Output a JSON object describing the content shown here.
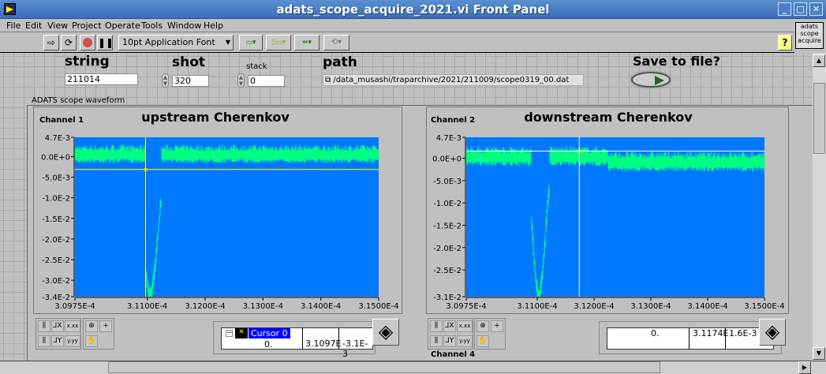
{
  "window": {
    "title": "adats_scope_acquire_2021.vi Front Panel",
    "minimize": "_",
    "maximize": "□",
    "close": "✕"
  },
  "menu": [
    "File",
    "Edit",
    "View",
    "Project",
    "Operate",
    "Tools",
    "Window",
    "Help"
  ],
  "toolbar": {
    "font_select": "10pt Application Font",
    "help": "?",
    "vi_icon": [
      "adats",
      "scope",
      "acquire"
    ]
  },
  "controls": {
    "string": {
      "label": "string",
      "value": "211014"
    },
    "shot": {
      "label": "shot",
      "value": "320"
    },
    "stack": {
      "label": "stack",
      "value": "0"
    },
    "path": {
      "label": "path",
      "value": "/data_musashi/traparchive/2021/211009/scope0319_00.dat"
    },
    "save": {
      "label": "Save to file?"
    },
    "cluster_label": "ADATS scope waveform"
  },
  "colors": {
    "plot_bg": "#0078ff",
    "trace": "#00ff80",
    "cursor1": "#ffff00",
    "cursor2": "#ffffff"
  },
  "chart_data": [
    {
      "type": "line",
      "plot_label": "Channel 1",
      "title": "upstream Cherenkov",
      "xlim": [
        0.00030975,
        0.000315
      ],
      "ylim": [
        -0.034,
        0.0047
      ],
      "x_ticks": [
        "3.0975E-4",
        "3.1100E-4",
        "3.1200E-4",
        "3.1300E-4",
        "3.1400E-4",
        "3.1500E-4"
      ],
      "x_tick_values": [
        0.00030975,
        0.000311,
        0.000312,
        0.000313,
        0.000314,
        0.000315
      ],
      "y_ticks": [
        "4.7E-3",
        "0.0E+0",
        "-5.0E-3",
        "-1.0E-2",
        "-1.5E-2",
        "-2.0E-2",
        "-2.5E-2",
        "-3.0E-2",
        "-3.4E-2"
      ],
      "y_tick_values": [
        0.0047,
        0,
        -0.005,
        -0.01,
        -0.015,
        -0.02,
        -0.025,
        -0.03,
        -0.034
      ],
      "baseline": 0.0005,
      "noise": 0.0017,
      "pulse": {
        "center": 0.00031105,
        "depth": -0.034,
        "width": 1.8e-07,
        "start": 0.00031097,
        "end": 0.00031125
      },
      "cursor": {
        "name": "Cursor 0",
        "index": "0.",
        "x": "3.1097E",
        "y": "-3.1E-3",
        "xv": 0.00031097,
        "yv": -0.0031
      }
    },
    {
      "type": "line",
      "plot_label": "Channel 2",
      "title": "downstream Cherenkov",
      "xlim": [
        0.00030975,
        0.000315
      ],
      "ylim": [
        -0.031,
        0.0047
      ],
      "x_ticks": [
        "3.0975E-4",
        "3.1100E-4",
        "3.1200E-4",
        "3.1300E-4",
        "3.1400E-4",
        "3.1500E-4"
      ],
      "x_tick_values": [
        0.00030975,
        0.000311,
        0.000312,
        0.000313,
        0.000314,
        0.000315
      ],
      "y_ticks": [
        "4.7E-3",
        "0.0E+0",
        "-5.0E-3",
        "-1.0E-2",
        "-1.5E-2",
        "-2.0E-2",
        "-2.5E-2",
        "-3.1E-2"
      ],
      "y_tick_values": [
        0.0047,
        0,
        -0.005,
        -0.01,
        -0.015,
        -0.02,
        -0.025,
        -0.031
      ],
      "baseline": 0.0003,
      "noise": 0.0017,
      "pulse": {
        "center": 0.00031103,
        "depth": -0.031,
        "width": 1.5e-07,
        "start": 0.0003109,
        "end": 0.00031122
      },
      "cursor": {
        "name": "",
        "index": "0.",
        "x": "3.1174E",
        "y": "1.6E-3",
        "xv": 0.00031174,
        "yv": 0.0016
      }
    }
  ],
  "channel4_label": "Channel 4"
}
